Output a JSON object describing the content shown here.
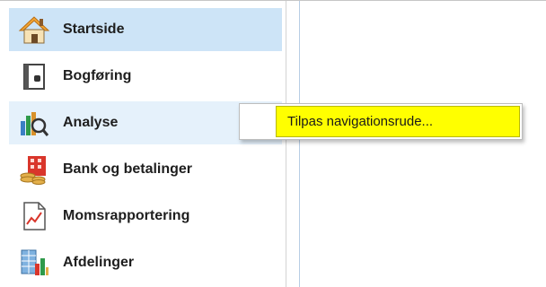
{
  "sidebar": {
    "items": [
      {
        "label": "Startside",
        "icon": "home-icon",
        "state": "selected"
      },
      {
        "label": "Bogføring",
        "icon": "ledger-book-icon",
        "state": "normal"
      },
      {
        "label": "Analyse",
        "icon": "analysis-chart-magnifier-icon",
        "state": "hover"
      },
      {
        "label": "Bank og betalinger",
        "icon": "bank-payments-icon",
        "state": "normal"
      },
      {
        "label": "Momsrapportering",
        "icon": "vat-report-icon",
        "state": "normal"
      },
      {
        "label": "Afdelinger",
        "icon": "departments-icon",
        "state": "normal"
      }
    ]
  },
  "context_menu": {
    "items": [
      {
        "label": "Tilpas navigationsrude..."
      }
    ]
  },
  "colors": {
    "selected_bg": "#cde4f7",
    "hover_bg": "#e5f1fb",
    "menu_highlight": "#ffff00"
  }
}
